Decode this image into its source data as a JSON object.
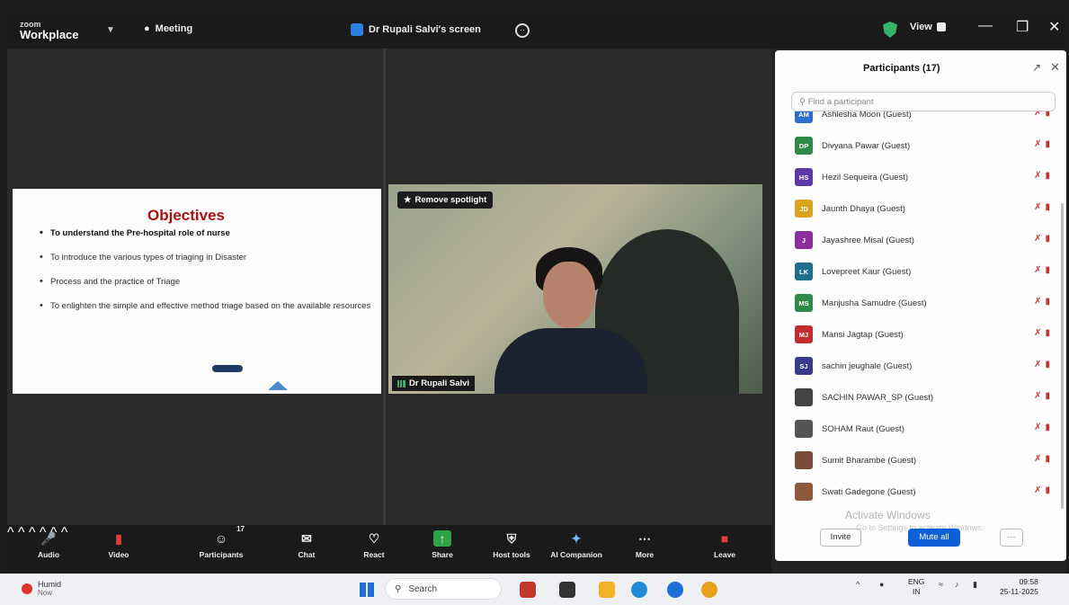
{
  "app": {
    "logo_line1": "zoom",
    "logo_line2": "Workplace",
    "meeting_label": "Meeting",
    "screen_share_label": "Dr Rupali Salvi's screen",
    "view_label": "View"
  },
  "slide": {
    "title": "Objectives",
    "bullets": [
      "To understand the Pre-hospital role of nurse",
      "To introduce the various types of triaging in Disaster",
      "Process and the practice of Triage",
      "To enlighten the simple and effective method triage based on the available resources"
    ]
  },
  "video": {
    "spotlight_label": "Remove spotlight",
    "name": "Dr Rupali Salvi"
  },
  "participants": {
    "title": "Participants (17)",
    "search_placeholder": "Find a participant",
    "list": [
      {
        "name": "Ashlesha Moon (Guest)",
        "initials": "AM",
        "color": "#2c6ecb"
      },
      {
        "name": "Divyana Pawar (Guest)",
        "initials": "DP",
        "color": "#2f8a4a"
      },
      {
        "name": "Hezil Sequeira (Guest)",
        "initials": "HS",
        "color": "#5b3aa8"
      },
      {
        "name": "Jaunth Dhaya (Guest)",
        "initials": "JD",
        "color": "#d9a520"
      },
      {
        "name": "Jayashree Misal (Guest)",
        "initials": "J",
        "color": "#8c2f9c"
      },
      {
        "name": "Lovepreet Kaur (Guest)",
        "initials": "LK",
        "color": "#1f6e8a"
      },
      {
        "name": "Manjusha Samudre (Guest)",
        "initials": "MS",
        "color": "#2f8a4a"
      },
      {
        "name": "Mansi Jagtap (Guest)",
        "initials": "MJ",
        "color": "#c22e2e"
      },
      {
        "name": "sachin jeughale (Guest)",
        "initials": "SJ",
        "color": "#3a3a8c"
      },
      {
        "name": "SACHIN PAWAR_SP (Guest)",
        "initials": "",
        "color": "#444444"
      },
      {
        "name": "SOHAM Raut (Guest)",
        "initials": "",
        "color": "#555555"
      },
      {
        "name": "Sumit Bharambe (Guest)",
        "initials": "",
        "color": "#7a4a3a"
      },
      {
        "name": "Swati Gadegone (Guest)",
        "initials": "",
        "color": "#8c5a3a"
      }
    ],
    "invite_label": "Invite",
    "mute_all_label": "Mute all",
    "activate_text": "Activate Windows",
    "activate_sub": "Go to Settings to activate Windows."
  },
  "toolbar": {
    "audio": "Audio",
    "video": "Video",
    "participants": "Participants",
    "participants_count": "17",
    "chat": "Chat",
    "react": "React",
    "share": "Share",
    "host_tools": "Host tools",
    "ai_companion": "AI Companion",
    "more": "More",
    "leave": "Leave"
  },
  "taskbar": {
    "weather_title": "Humid",
    "weather_sub": "Now",
    "search_label": "Search",
    "lang_line1": "ENG",
    "lang_line2": "IN",
    "time": "09:58",
    "date": "25-11-2025"
  },
  "colors": {
    "accent": "#0e5fd8",
    "slide_title": "#a81212",
    "shield": "#35b36a"
  }
}
